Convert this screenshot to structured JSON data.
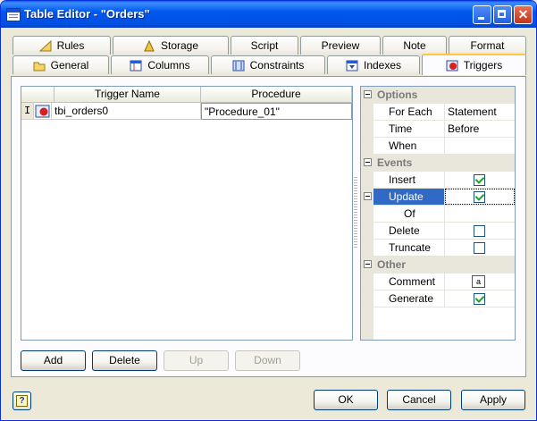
{
  "window": {
    "title": "Table Editor - \"Orders\""
  },
  "tabs_back": [
    {
      "label": "Rules",
      "icon": "ruler-icon"
    },
    {
      "label": "Storage",
      "icon": "storage-icon"
    },
    {
      "label": "Script",
      "icon": ""
    },
    {
      "label": "Preview",
      "icon": ""
    },
    {
      "label": "Note",
      "icon": ""
    },
    {
      "label": "Format",
      "icon": ""
    }
  ],
  "tabs_front": [
    {
      "label": "General",
      "icon": "folder-icon"
    },
    {
      "label": "Columns",
      "icon": "columns-icon"
    },
    {
      "label": "Constraints",
      "icon": "constraints-icon"
    },
    {
      "label": "Indexes",
      "icon": "indexes-icon"
    },
    {
      "label": "Triggers",
      "icon": "trigger-icon",
      "active": true
    }
  ],
  "grid": {
    "headers": [
      "Trigger Name",
      "Procedure"
    ],
    "rows": [
      {
        "marker": "I",
        "name": "tbi_orders0",
        "procedure": "\"Procedure_01\""
      }
    ]
  },
  "properties": {
    "options": {
      "label": "Options",
      "for_each": {
        "name": "For Each",
        "value": "Statement"
      },
      "time": {
        "name": "Time",
        "value": "Before"
      },
      "when": {
        "name": "When",
        "value": ""
      }
    },
    "events": {
      "label": "Events",
      "insert": {
        "name": "Insert",
        "checked": true
      },
      "update": {
        "name": "Update",
        "checked": true
      },
      "of": {
        "name": "Of",
        "value": ""
      },
      "delete": {
        "name": "Delete",
        "checked": false
      },
      "truncate": {
        "name": "Truncate",
        "checked": false
      }
    },
    "other": {
      "label": "Other",
      "comment": {
        "name": "Comment",
        "glyph": "a"
      },
      "generate": {
        "name": "Generate",
        "checked": true
      }
    }
  },
  "buttons": {
    "add": "Add",
    "delete": "Delete",
    "up": "Up",
    "down": "Down",
    "ok": "OK",
    "cancel": "Cancel",
    "apply": "Apply",
    "help": "?"
  }
}
